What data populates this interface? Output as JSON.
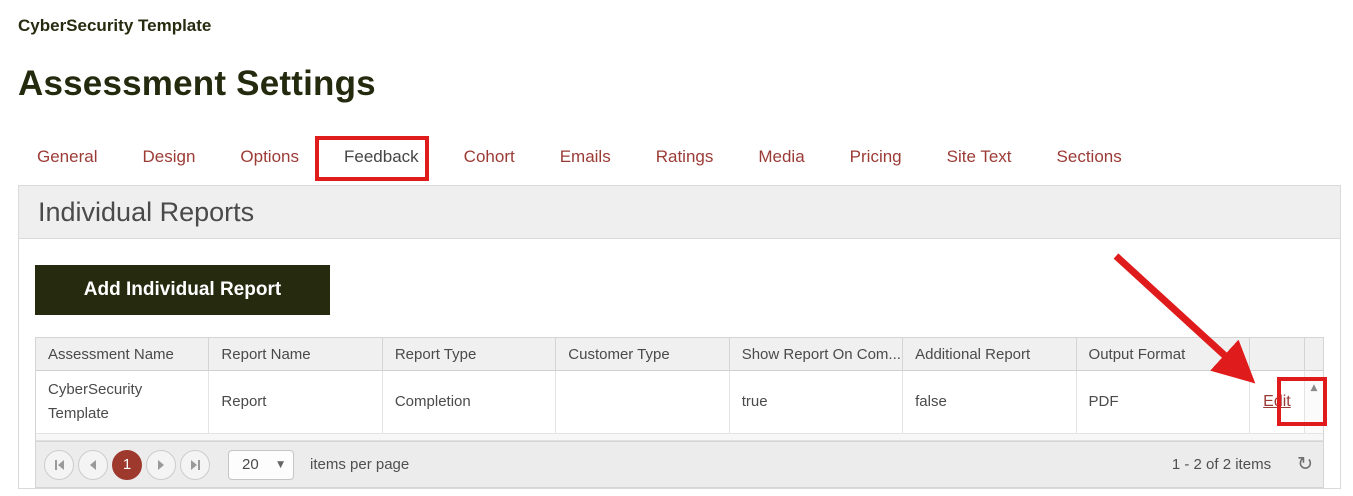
{
  "page": {
    "app_title": "CyberSecurity Template",
    "heading": "Assessment Settings"
  },
  "tabs": {
    "active": "Feedback",
    "items": [
      {
        "label": "General"
      },
      {
        "label": "Design"
      },
      {
        "label": "Options"
      },
      {
        "label": "Feedback"
      },
      {
        "label": "Cohort"
      },
      {
        "label": "Emails"
      },
      {
        "label": "Ratings"
      },
      {
        "label": "Media"
      },
      {
        "label": "Pricing"
      },
      {
        "label": "Site Text"
      },
      {
        "label": "Sections"
      }
    ]
  },
  "panel": {
    "title": "Individual Reports",
    "add_button_label": "Add Individual Report"
  },
  "grid": {
    "columns": [
      "Assessment Name",
      "Report Name",
      "Report Type",
      "Customer Type",
      "Show Report On Com...",
      "Additional Report",
      "Output Format"
    ],
    "row": {
      "cells": [
        "CyberSecurity Template",
        "Report",
        "Completion",
        "",
        "true",
        "false",
        "PDF"
      ],
      "edit_label": "Edit"
    }
  },
  "pager": {
    "current_page": "1",
    "page_size": "20",
    "items_per_page_label": "items per page",
    "range_label": "1 - 2 of 2 items"
  },
  "icons": {
    "refresh": "↻",
    "dropdown_arrow": "▼",
    "scroll_up": "▲"
  },
  "colors": {
    "tab_link": "#9b3b36",
    "heading": "#242a0e",
    "button_bg": "#262b10",
    "current_page_bg": "#9e392e",
    "annotation_red": "#e01b1b",
    "edit_link": "#9b3b36"
  }
}
